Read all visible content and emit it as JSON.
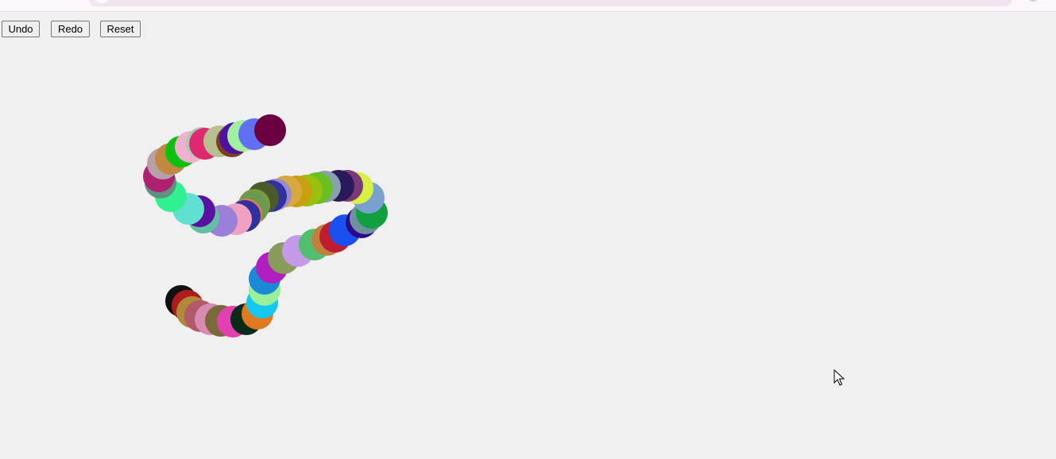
{
  "toolbar": {
    "undo_label": "Undo",
    "redo_label": "Redo",
    "reset_label": "Reset"
  },
  "drawing": {
    "stroke_colors": [
      "#111111",
      "#b01c1c",
      "#b08a3a",
      "#b05a6a",
      "#d88ab0",
      "#7a6a3a",
      "#e040b0",
      "#0a2a1a",
      "#e07a20",
      "#14c8f0",
      "#9af09a",
      "#1a8ad8",
      "#b020c0",
      "#8a9a5a",
      "#c49ae8",
      "#50c070",
      "#c08040",
      "#c01c30",
      "#1a50f0",
      "#2a0a8a",
      "#7090a0",
      "#10a040",
      "#7aa0d0",
      "#d8f040",
      "#7a3a7a",
      "#2a1a5a",
      "#88a0b0",
      "#6ac020",
      "#9ac010",
      "#c8a010",
      "#d8a840",
      "#9a8ad0",
      "#3030a0",
      "#4a5a2a",
      "#7a9a40",
      "#6a9a50",
      "#e07a50",
      "#3030a0",
      "#f0a0c0",
      "#9a80d8",
      "#60c0a0",
      "#5a10a0",
      "#60e0d0",
      "#30f090",
      "#609080",
      "#b02070",
      "#b8a0a8",
      "#c08840",
      "#10c010",
      "#f0b0d0",
      "#a0d0b0",
      "#e02870",
      "#b8c090",
      "#7a4020",
      "#5010a0",
      "#a0f0a0",
      "#6070f0",
      "#6a0040"
    ]
  }
}
